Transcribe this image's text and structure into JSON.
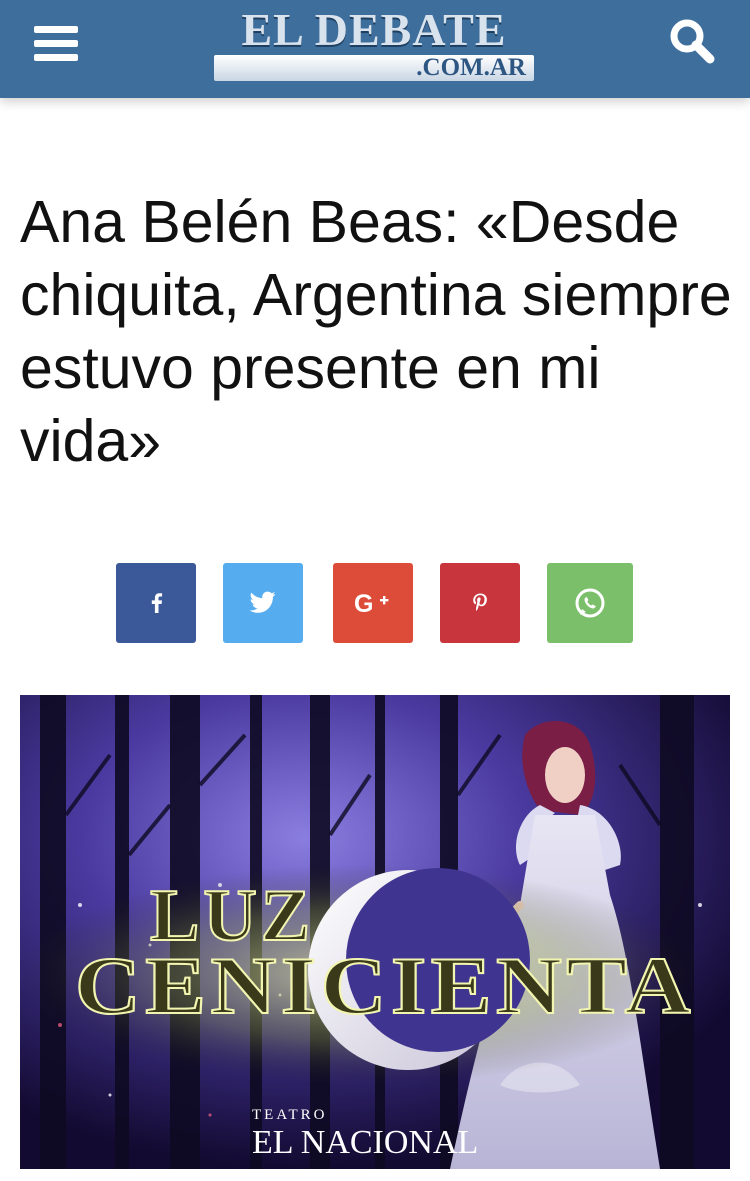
{
  "header": {
    "menu_icon": "hamburger-menu-icon",
    "logo_main": "EL DEBATE",
    "logo_sub": ".COM.AR",
    "search_icon": "search-icon",
    "background": "#3d6e9c"
  },
  "article": {
    "title": "Ana Belén Beas: «Desde chiquita, Argentina siempre estuvo presente en mi vida»"
  },
  "share": [
    {
      "network": "facebook",
      "icon": "facebook-icon",
      "color": "#3b5998"
    },
    {
      "network": "twitter",
      "icon": "twitter-icon",
      "color": "#55acee"
    },
    {
      "network": "google-plus",
      "icon": "google-plus-icon",
      "color": "#dd4b39"
    },
    {
      "network": "pinterest",
      "icon": "pinterest-icon",
      "color": "#c9353d"
    },
    {
      "network": "whatsapp",
      "icon": "whatsapp-icon",
      "color": "#7bbf6a"
    }
  ],
  "hero_image": {
    "show_title_line1": "LUZ",
    "show_title_line2": "CENICIENTA",
    "venue_small": "TEATRO",
    "venue": "EL NACIONAL"
  }
}
